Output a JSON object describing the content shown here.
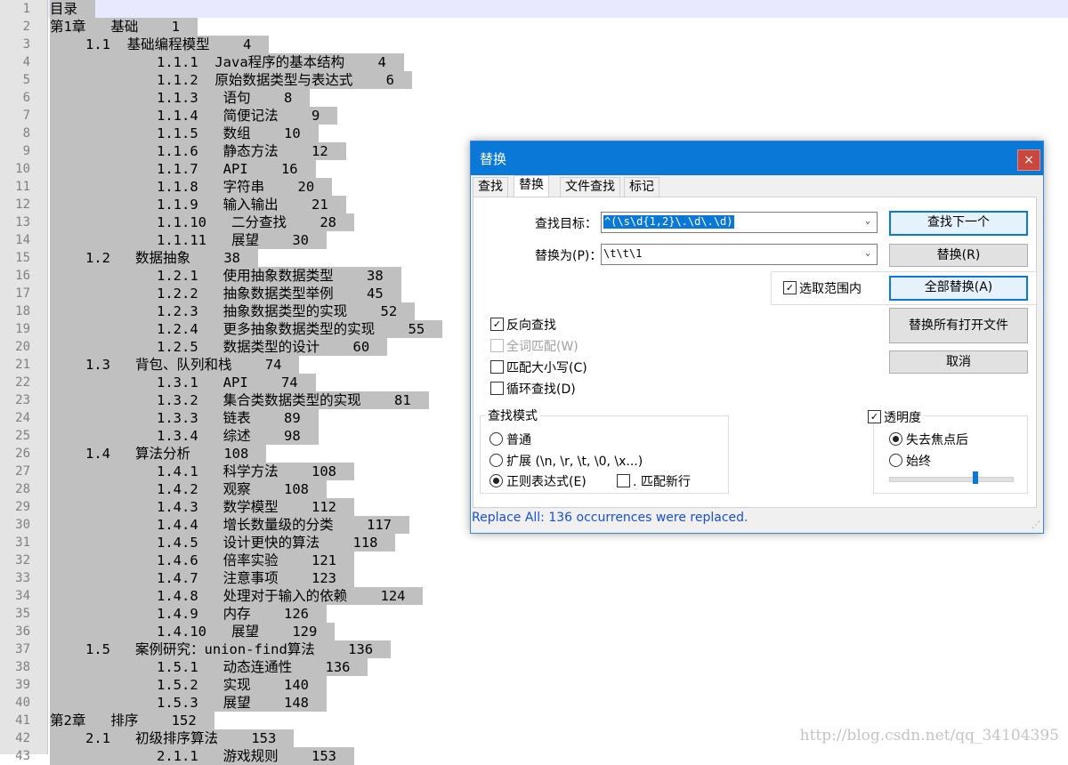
{
  "editor": {
    "lines": [
      {
        "n": "1",
        "text": "目录",
        "indent": 0
      },
      {
        "n": "2",
        "text": "第1章   基础    1",
        "indent": 0
      },
      {
        "n": "3",
        "text": "1.1  基础编程模型    4",
        "indent": 1
      },
      {
        "n": "4",
        "text": "1.1.1  Java程序的基本结构    4",
        "indent": 2
      },
      {
        "n": "5",
        "text": "1.1.2  原始数据类型与表达式    6",
        "indent": 2
      },
      {
        "n": "6",
        "text": "1.1.3   语句    8",
        "indent": 2
      },
      {
        "n": "7",
        "text": "1.1.4   简便记法    9",
        "indent": 2
      },
      {
        "n": "8",
        "text": "1.1.5   数组    10",
        "indent": 2
      },
      {
        "n": "9",
        "text": "1.1.6   静态方法    12",
        "indent": 2
      },
      {
        "n": "10",
        "text": "1.1.7   API    16",
        "indent": 2
      },
      {
        "n": "11",
        "text": "1.1.8   字符串    20",
        "indent": 2
      },
      {
        "n": "12",
        "text": "1.1.9   输入输出    21",
        "indent": 2
      },
      {
        "n": "13",
        "text": "1.1.10   二分查找    28",
        "indent": 2
      },
      {
        "n": "14",
        "text": "1.1.11   展望    30",
        "indent": 2
      },
      {
        "n": "15",
        "text": "1.2   数据抽象    38",
        "indent": 1
      },
      {
        "n": "16",
        "text": "1.2.1   使用抽象数据类型    38",
        "indent": 2
      },
      {
        "n": "17",
        "text": "1.2.2   抽象数据类型举例    45",
        "indent": 2
      },
      {
        "n": "18",
        "text": "1.2.3   抽象数据类型的实现    52",
        "indent": 2
      },
      {
        "n": "19",
        "text": "1.2.4   更多抽象数据类型的实现    55",
        "indent": 2
      },
      {
        "n": "20",
        "text": "1.2.5   数据类型的设计    60",
        "indent": 2
      },
      {
        "n": "21",
        "text": "1.3   背包、队列和栈    74",
        "indent": 1
      },
      {
        "n": "22",
        "text": "1.3.1   API    74",
        "indent": 2
      },
      {
        "n": "23",
        "text": "1.3.2   集合类数据类型的实现    81",
        "indent": 2
      },
      {
        "n": "24",
        "text": "1.3.3   链表    89",
        "indent": 2
      },
      {
        "n": "25",
        "text": "1.3.4   综述    98",
        "indent": 2
      },
      {
        "n": "26",
        "text": "1.4   算法分析    108",
        "indent": 1
      },
      {
        "n": "27",
        "text": "1.4.1   科学方法    108",
        "indent": 2
      },
      {
        "n": "28",
        "text": "1.4.2   观察    108",
        "indent": 2
      },
      {
        "n": "29",
        "text": "1.4.3   数学模型    112",
        "indent": 2
      },
      {
        "n": "30",
        "text": "1.4.4   增长数量级的分类    117",
        "indent": 2
      },
      {
        "n": "31",
        "text": "1.4.5   设计更快的算法    118",
        "indent": 2
      },
      {
        "n": "32",
        "text": "1.4.6   倍率实验    121",
        "indent": 2
      },
      {
        "n": "33",
        "text": "1.4.7   注意事项    123",
        "indent": 2
      },
      {
        "n": "34",
        "text": "1.4.8   处理对于输入的依赖    124",
        "indent": 2
      },
      {
        "n": "35",
        "text": "1.4.9   内存    126",
        "indent": 2
      },
      {
        "n": "36",
        "text": "1.4.10   展望    129",
        "indent": 2
      },
      {
        "n": "37",
        "text": "1.5   案例研究：union-find算法    136",
        "indent": 1
      },
      {
        "n": "38",
        "text": "1.5.1   动态连通性    136",
        "indent": 2
      },
      {
        "n": "39",
        "text": "1.5.2   实现    140",
        "indent": 2
      },
      {
        "n": "40",
        "text": "1.5.3   展望    148",
        "indent": 2
      },
      {
        "n": "41",
        "text": "第2章   排序    152",
        "indent": 0
      },
      {
        "n": "42",
        "text": "2.1   初级排序算法    153",
        "indent": 1
      },
      {
        "n": "43",
        "text": "2.1.1   游戏规则    153",
        "indent": 2
      }
    ],
    "watermark": "http://blog.csdn.net/qq_34104395"
  },
  "dialog": {
    "title": "替换",
    "close_glyph": "×",
    "tabs": [
      "查找",
      "替换",
      "文件查找",
      "标记"
    ],
    "find_label": "查找目标：",
    "find_value": "^(\\s\\d{1,2}\\.\\d\\.\\d)",
    "replace_label": "替换为(P)：",
    "replace_value": "\\t\\t\\1",
    "buttons": {
      "find_next": "查找下一个",
      "replace": "替换(R)",
      "replace_all": "全部替换(A)",
      "replace_all_open": "替换所有打开文件",
      "cancel": "取消"
    },
    "in_selection": "选取范围内",
    "options": {
      "backward": "反向查找",
      "whole_word": "全词匹配(W)",
      "match_case": "匹配大小写(C)",
      "wrap": "循环查找(D)"
    },
    "search_mode": {
      "title": "查找模式",
      "normal": "普通",
      "extended": "扩展 (\\n, \\r, \\t, \\0, \\x...)",
      "regex": "正则表达式(E)",
      "dot_newline": ". 匹配新行"
    },
    "transparency": {
      "title": "透明度",
      "on_lose_focus": "失去焦点后",
      "always": "始终",
      "level": 0.68
    },
    "status": "Replace All: 136 occurrences were replaced.",
    "check_glyph": "✓",
    "dropdown_glyph": "⌄"
  }
}
